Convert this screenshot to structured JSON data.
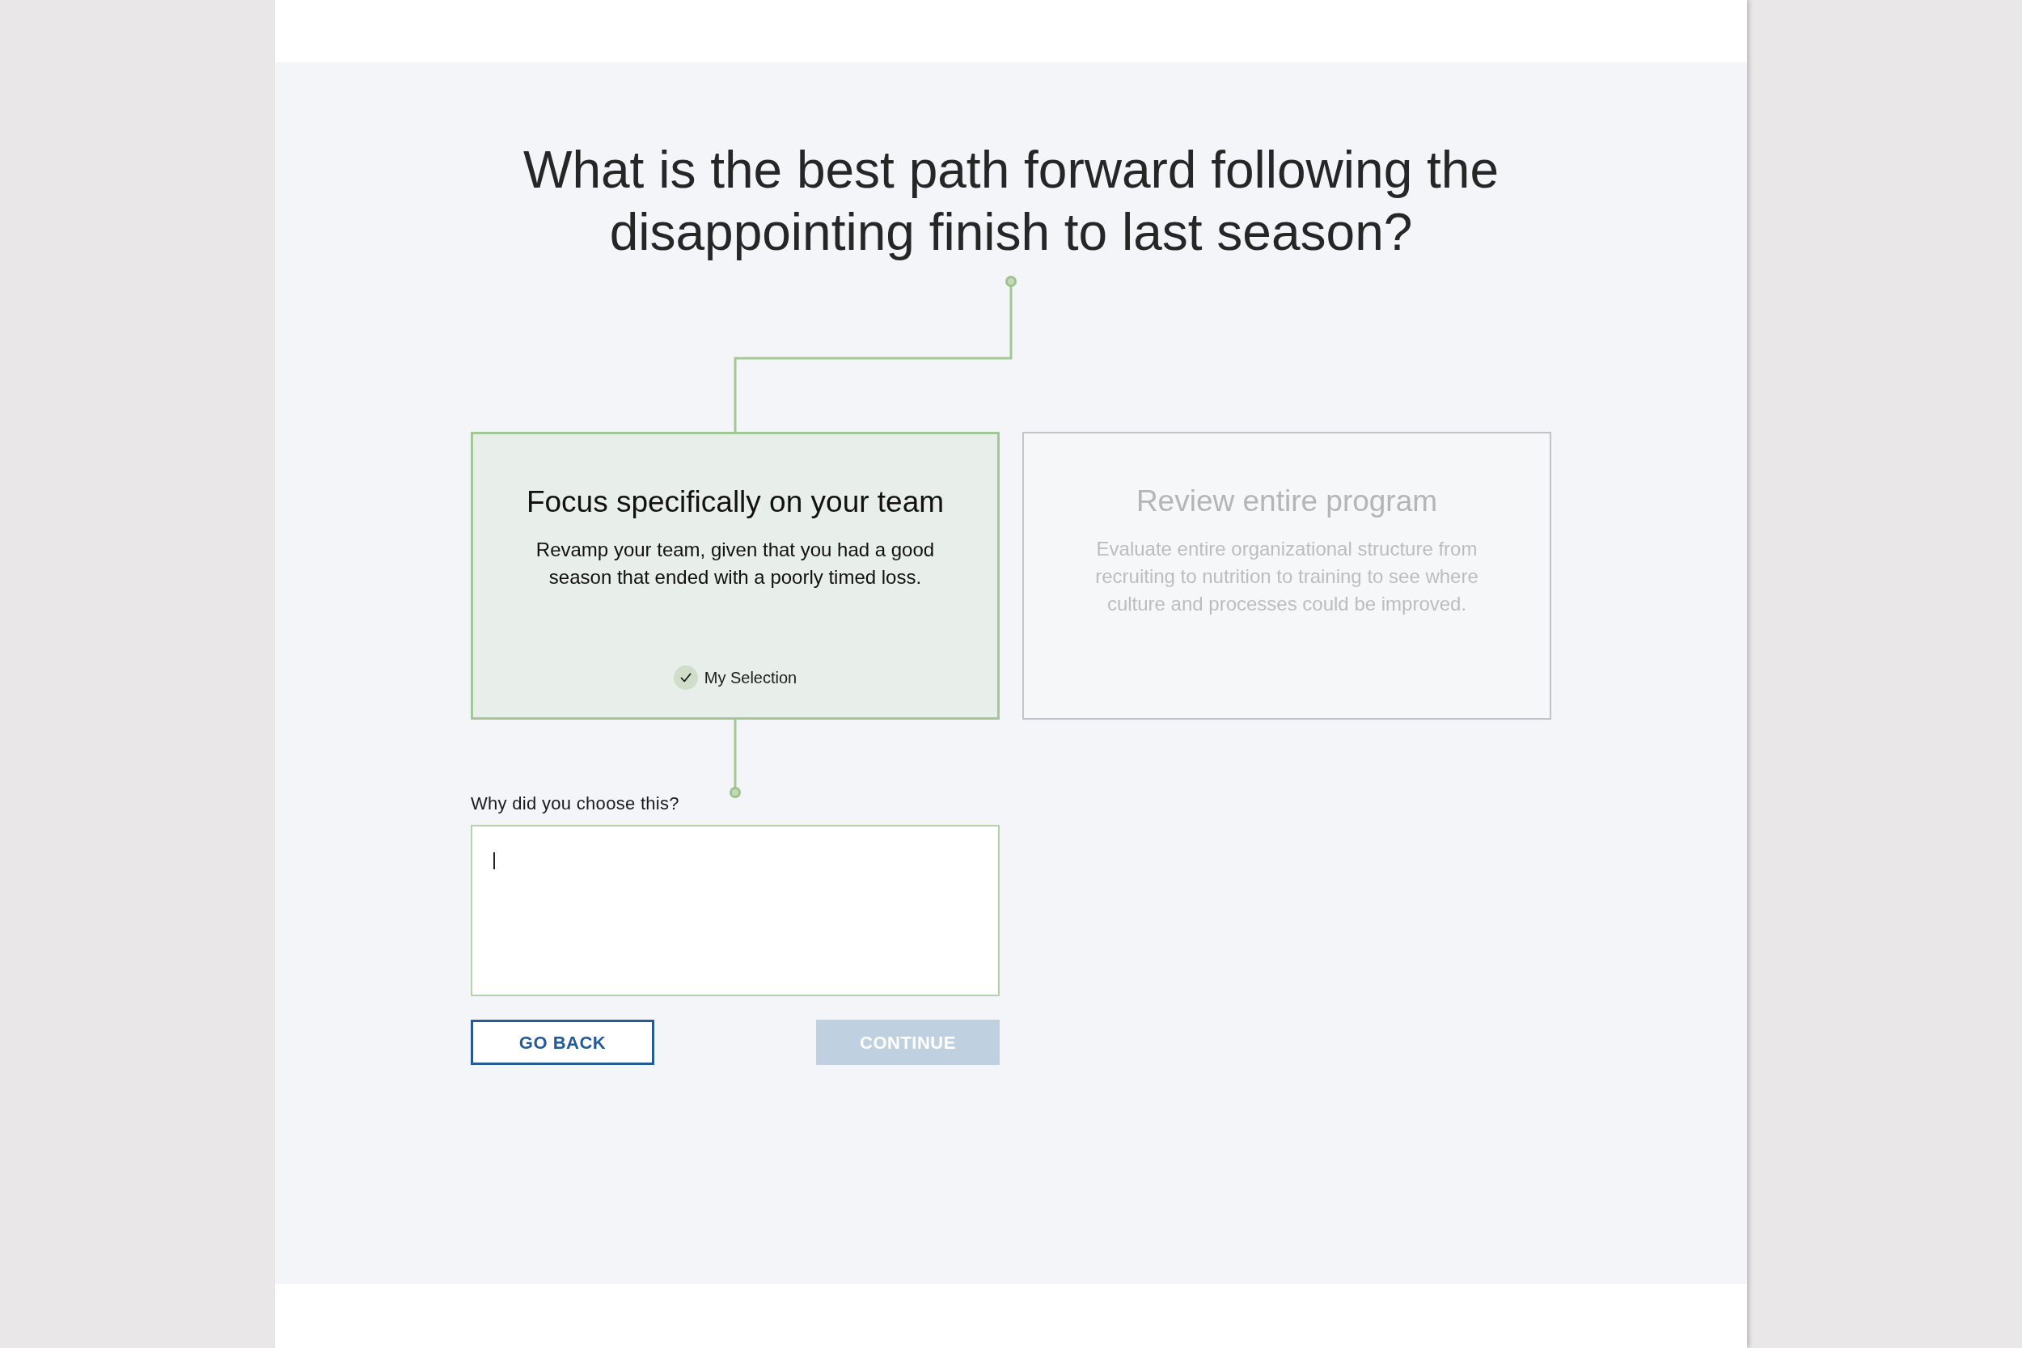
{
  "question": {
    "title": "What is the best path forward following the disappointing finish to last season?"
  },
  "options": [
    {
      "title": "Focus specifically on your team",
      "description": "Revamp your team, given that you had a good season that ended with a poorly timed loss.",
      "selected": true
    },
    {
      "title": "Review entire program",
      "description": "Evaluate entire organizational structure from recruiting to nutrition to training to see where culture and processes could be improved.",
      "selected": false
    }
  ],
  "selection_badge": "My Selection",
  "follow_up": {
    "label": "Why did you choose this?",
    "focused": true
  },
  "buttons": [
    {
      "label": "GO BACK",
      "kind": "secondary",
      "disabled": false
    },
    {
      "label": "CONTINUE",
      "kind": "primary",
      "disabled": true
    }
  ]
}
